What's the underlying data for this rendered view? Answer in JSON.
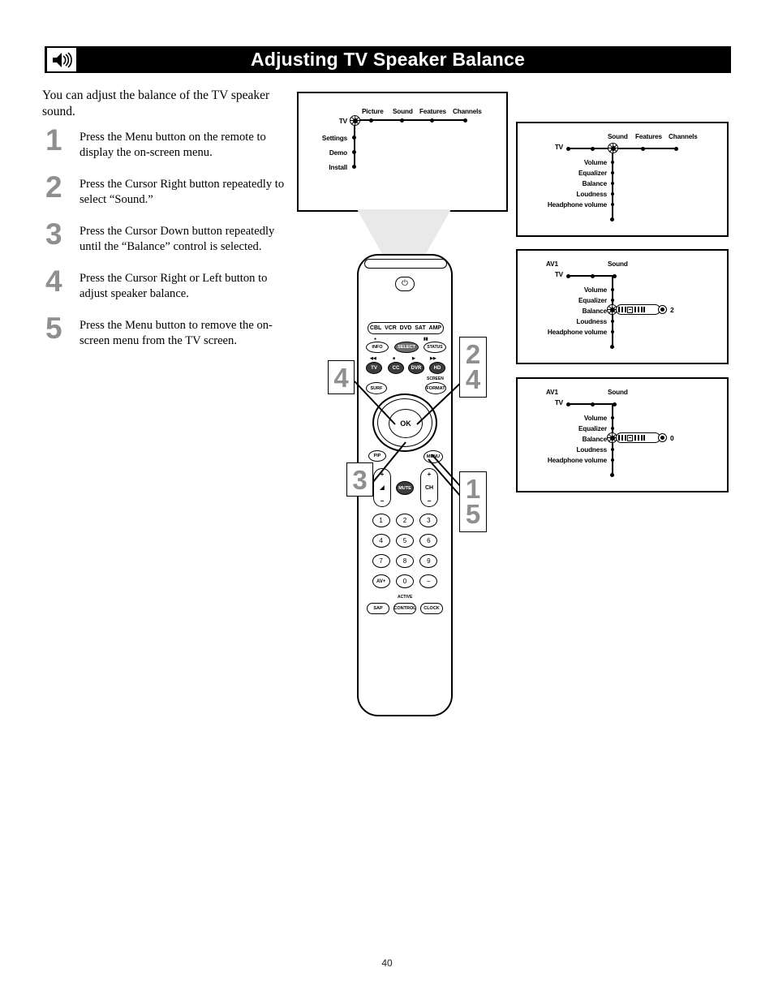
{
  "header": {
    "title": "Adjusting TV Speaker Balance",
    "icon": "speaker-volume-icon"
  },
  "intro": "You can adjust the balance of the TV speaker sound.",
  "steps": [
    {
      "num": "1",
      "text": "Press the Menu button on the remote to display the on-screen menu."
    },
    {
      "num": "2",
      "text": "Press the Cursor Right button repeatedly to select “Sound.”"
    },
    {
      "num": "3",
      "text": "Press the Cursor Down button repeatedly until the “Balance” control is selected."
    },
    {
      "num": "4",
      "text": "Press the Cursor Right or Left button to adjust speaker balance."
    },
    {
      "num": "5",
      "text": "Press the Menu button to remove the on-screen menu from the TV screen."
    }
  ],
  "menus": {
    "panel1": {
      "root": "TV",
      "top_items": [
        "Picture",
        "Sound",
        "Features",
        "Channels"
      ],
      "side_items": [
        "Settings",
        "Demo",
        "Install"
      ]
    },
    "panel2": {
      "root": "TV",
      "top_items": [
        "Sound",
        "Features",
        "Channels"
      ],
      "sub_items": [
        "Volume",
        "Equalizer",
        "Balance",
        "Loudness",
        "Headphone  volume"
      ]
    },
    "panel3": {
      "source": "AV1",
      "root": "TV",
      "selected": "Sound",
      "sub_items": [
        "Volume",
        "Equalizer",
        "Balance",
        "Loudness",
        "Headphone  volume"
      ],
      "balance_value": "2"
    },
    "panel4": {
      "source": "AV1",
      "root": "TV",
      "selected": "Sound",
      "sub_items": [
        "Volume",
        "Equalizer",
        "Balance",
        "Loudness",
        "Headphone  volume"
      ],
      "balance_value": "0"
    }
  },
  "remote": {
    "power": "⏻",
    "devices": [
      "CBL",
      "VCR",
      "DVD",
      "SAT",
      "AMP"
    ],
    "row_info": [
      "INFO",
      "SELECT",
      "STATUS"
    ],
    "transport_marks": [
      "●",
      "▮▮"
    ],
    "row_mode": [
      "TV",
      "CC",
      "DVR",
      "HD"
    ],
    "transport_marks2": [
      "◀◀",
      "■",
      "▶",
      "▶▶"
    ],
    "screen_label": "SCREEN",
    "surf": "SURF",
    "format": "FORMAT",
    "ok": "OK",
    "pip": "PIP",
    "menu": "MENU",
    "volume": {
      "plus": "+",
      "mid": "◢",
      "minus": "−"
    },
    "mute": "MUTE",
    "channel": {
      "plus": "+",
      "mid": "CH",
      "minus": "−"
    },
    "keys": [
      "1",
      "2",
      "3",
      "4",
      "5",
      "6",
      "7",
      "8",
      "9",
      "AV+",
      "0",
      "−"
    ],
    "active_label": "ACTIVE",
    "bottom_buttons": [
      "SAP",
      "CONTROL",
      "CLOCK"
    ]
  },
  "callouts": {
    "left_four": "4",
    "right_two": "2",
    "right_four": "4",
    "left_three": "3",
    "right_one": "1",
    "right_five": "5"
  },
  "page_number": "40"
}
